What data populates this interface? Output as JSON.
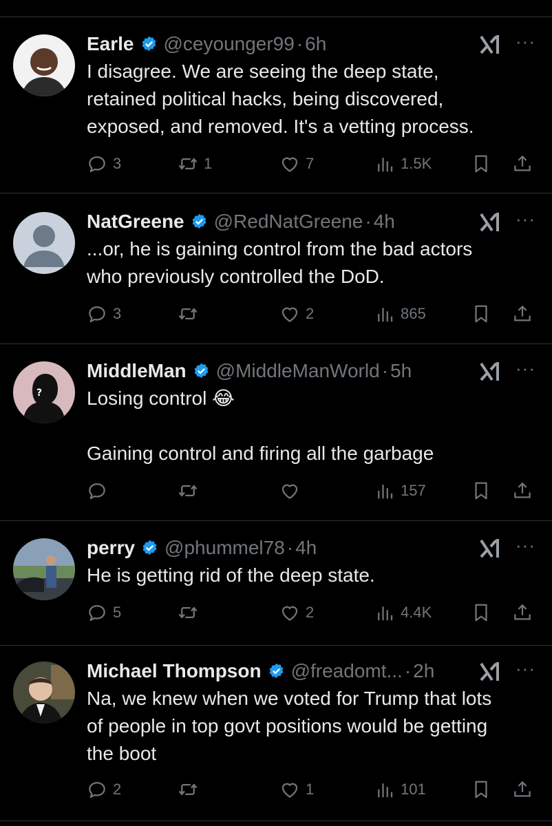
{
  "tweets": [
    {
      "name": "Earle",
      "handle": "@ceyounger99",
      "time": "6h",
      "text": "I disagree. We are seeing the deep state,\nretained political hacks, being discovered,\nexposed, and removed. It's a vetting process.",
      "replies": "3",
      "reposts": "1",
      "likes": "7",
      "views": "1.5K"
    },
    {
      "name": "NatGreene",
      "handle": "@RedNatGreene",
      "time": "4h",
      "text": "...or, he is gaining control from the bad actors\nwho previously controlled the DoD.",
      "replies": "3",
      "reposts": "",
      "likes": "2",
      "views": "865"
    },
    {
      "name": "MiddleMan",
      "handle": "@MiddleManWorld",
      "time": "5h",
      "text": "Losing control 😂\n\nGaining control and firing all the garbage",
      "replies": "",
      "reposts": "",
      "likes": "",
      "views": "157"
    },
    {
      "name": "perry",
      "handle": "@phummel78",
      "time": "4h",
      "text": "He is getting rid of the deep state.",
      "replies": "5",
      "reposts": "",
      "likes": "2",
      "views": "4.4K"
    },
    {
      "name": "Michael Thompson",
      "handle": "@freadomt...",
      "time": "2h",
      "text": "Na, we knew when we voted for Trump that lots\nof people in top govt positions would be getting\nthe boot",
      "replies": "2",
      "reposts": "",
      "likes": "1",
      "views": "101"
    }
  ],
  "separator": "·",
  "more_label": "···",
  "colors": {
    "background": "#000000",
    "text": "#e7e9ea",
    "muted": "#71767b",
    "verified": "#1d9bf0",
    "divider": "#2f3336"
  },
  "icons": [
    "reply-icon",
    "repost-icon",
    "like-icon",
    "views-icon",
    "bookmark-icon",
    "share-icon",
    "verified-badge-icon",
    "grok-icon",
    "more-icon"
  ]
}
